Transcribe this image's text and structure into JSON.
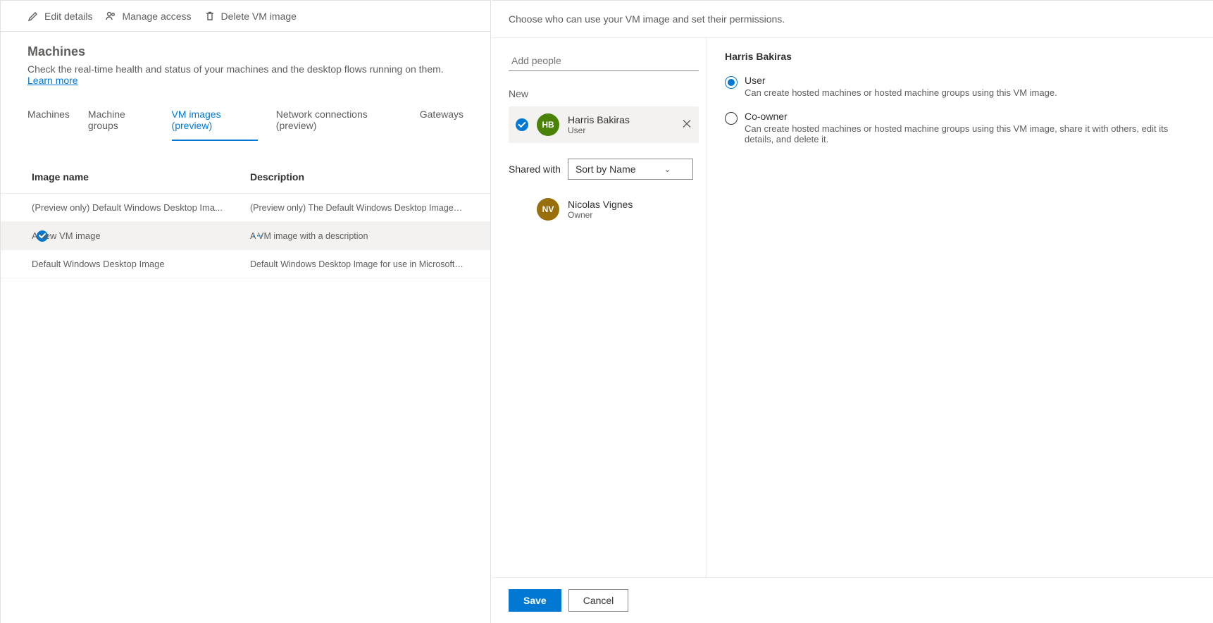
{
  "toolbar": {
    "edit_label": "Edit details",
    "access_label": "Manage access",
    "delete_label": "Delete VM image"
  },
  "page": {
    "title": "Machines",
    "subtitle_prefix": "Check the real-time health and status of your machines and the desktop flows running on them. ",
    "learn_more": "Learn more"
  },
  "tabs": {
    "items": [
      {
        "label": "Machines"
      },
      {
        "label": "Machine groups"
      },
      {
        "label": "VM images (preview)",
        "active": true
      },
      {
        "label": "Network connections (preview)"
      },
      {
        "label": "Gateways"
      }
    ]
  },
  "table": {
    "col_name": "Image name",
    "col_desc": "Description",
    "rows": [
      {
        "name": "(Preview only) Default Windows Desktop Ima...",
        "desc": "(Preview only) The Default Windows Desktop Image for use i..."
      },
      {
        "name": "A new VM image",
        "desc": "A VM image with a description",
        "selected": true
      },
      {
        "name": "Default Windows Desktop Image",
        "desc": "Default Windows Desktop Image for use in Microsoft Deskto..."
      }
    ]
  },
  "panel": {
    "instruction": "Choose who can use your VM image and set their permissions.",
    "add_placeholder": "Add people",
    "new_label": "New",
    "new_people": [
      {
        "initials": "HB",
        "name": "Harris Bakiras",
        "role": "User",
        "color": "green"
      }
    ],
    "shared_label": "Shared with",
    "sort_label": "Sort by Name",
    "shared_people": [
      {
        "initials": "NV",
        "name": "Nicolas Vignes",
        "role": "Owner",
        "color": "olive"
      }
    ],
    "detail": {
      "heading": "Harris Bakiras",
      "options": [
        {
          "title": "User",
          "desc": "Can create hosted machines or hosted machine groups using this VM image.",
          "selected": true
        },
        {
          "title": "Co-owner",
          "desc": "Can create hosted machines or hosted machine groups using this VM image, share it with others, edit its details, and delete it."
        }
      ]
    },
    "save_label": "Save",
    "cancel_label": "Cancel"
  }
}
